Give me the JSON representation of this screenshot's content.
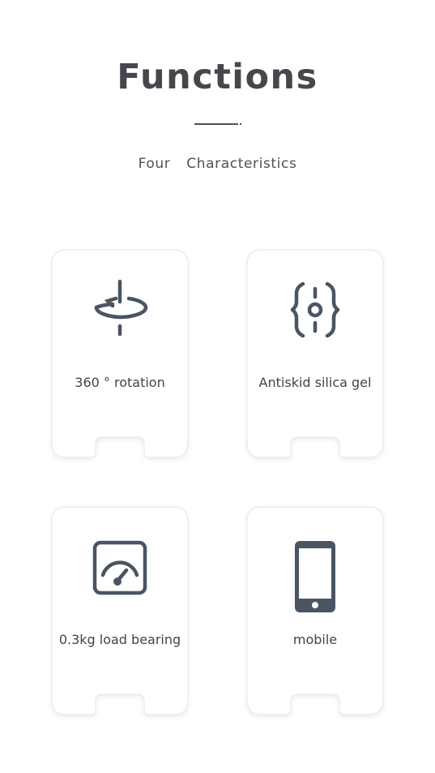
{
  "header": {
    "title": "Functions",
    "subtitle": "Four  Characteristics"
  },
  "features": [
    {
      "label": "360 ° rotation",
      "icon": "rotation-360-icon"
    },
    {
      "label": "Antiskid silica gel",
      "icon": "antiskid-gel-icon"
    },
    {
      "label": "0.3kg load bearing",
      "icon": "gauge-icon"
    },
    {
      "label": "mobile",
      "icon": "mobile-phone-icon"
    }
  ],
  "colors": {
    "icon": "#4a5563",
    "title": "#45474c",
    "divider": "#5a4a52",
    "card_border": "#e6e8ec",
    "background": "#ffffff"
  }
}
